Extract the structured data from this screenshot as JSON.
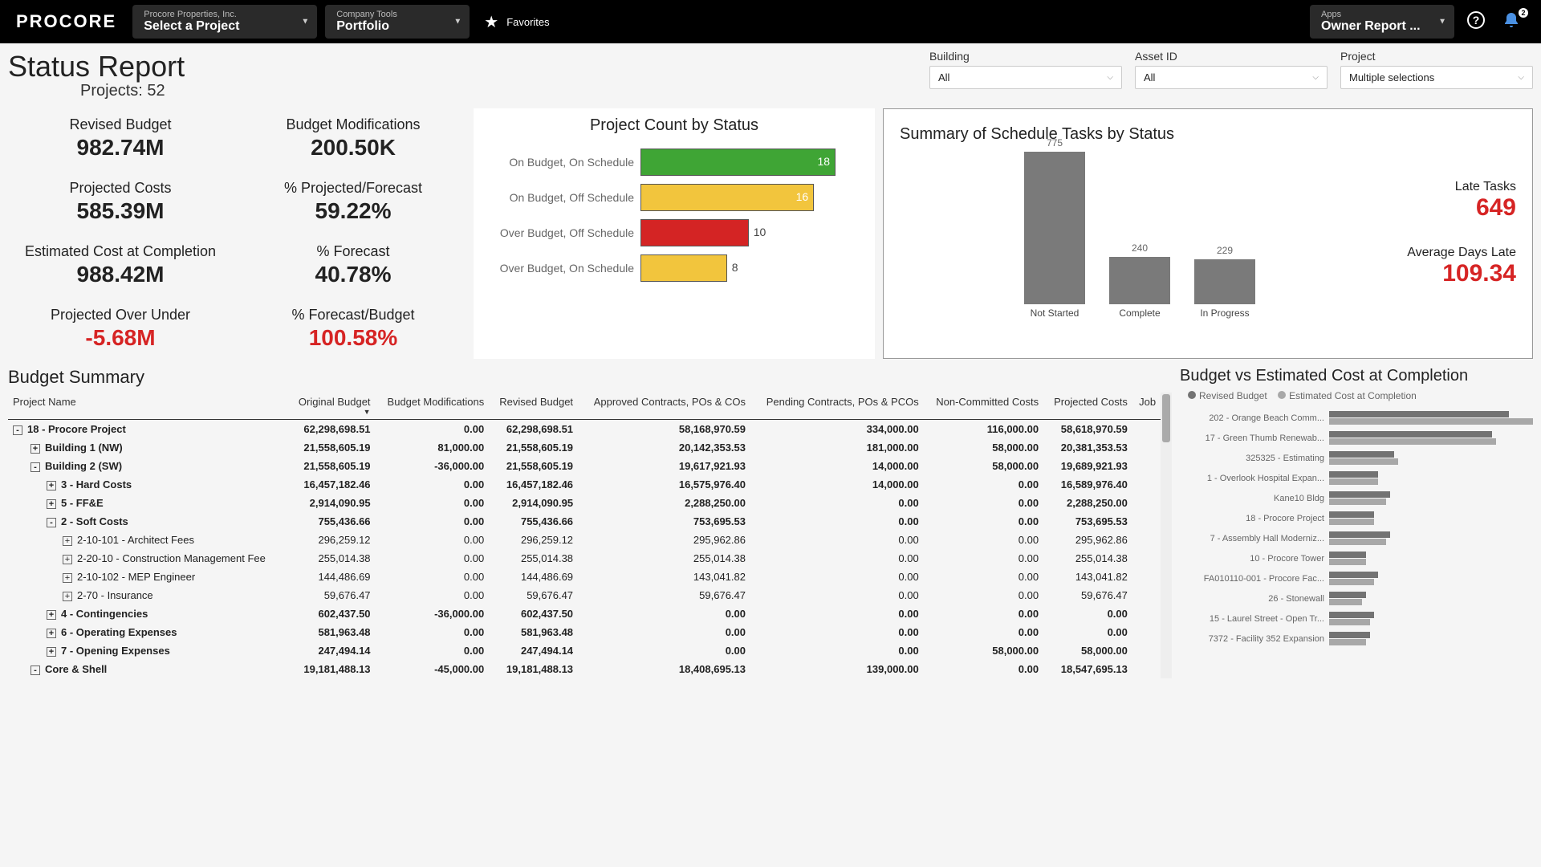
{
  "topbar": {
    "logo": "PROCORE",
    "project_selector": {
      "small": "Procore Properties, Inc.",
      "main": "Select a Project"
    },
    "tool_selector": {
      "small": "Company Tools",
      "main": "Portfolio"
    },
    "favorites": "Favorites",
    "apps_selector": {
      "small": "Apps",
      "main": "Owner Report ..."
    },
    "notif_count": "2"
  },
  "header": {
    "title": "Status Report",
    "subtitle": "Projects: 52",
    "filters": {
      "building": {
        "label": "Building",
        "value": "All"
      },
      "asset": {
        "label": "Asset ID",
        "value": "All"
      },
      "project": {
        "label": "Project",
        "value": "Multiple selections"
      }
    }
  },
  "kpi_left": [
    {
      "label": "Revised Budget",
      "value": "982.74M"
    },
    {
      "label": "Projected Costs",
      "value": "585.39M"
    },
    {
      "label": "Estimated Cost at Completion",
      "value": "988.42M"
    },
    {
      "label": "Projected Over Under",
      "value": "-5.68M",
      "neg": true
    }
  ],
  "kpi_right": [
    {
      "label": "Budget Modifications",
      "value": "200.50K"
    },
    {
      "label": "% Projected/Forecast",
      "value": "59.22%"
    },
    {
      "label": "% Forecast",
      "value": "40.78%"
    },
    {
      "label": "% Forecast/Budget",
      "value": "100.58%",
      "neg": true
    }
  ],
  "chart_data": [
    {
      "type": "bar",
      "title": "Project Count by Status",
      "categories": [
        "On Budget, On Schedule",
        "On Budget, Off Schedule",
        "Over Budget, Off Schedule",
        "Over Budget, On Schedule"
      ],
      "values": [
        18,
        16,
        10,
        8
      ],
      "colors": [
        "#3fa535",
        "#f2c53d",
        "#d42424",
        "#f2c53d"
      ]
    },
    {
      "type": "bar",
      "title": "Summary of Schedule Tasks by Status",
      "categories": [
        "Not Started",
        "Complete",
        "In Progress"
      ],
      "values": [
        775,
        240,
        229
      ]
    },
    {
      "type": "bar",
      "title": "Budget vs Estimated Cost at Completion",
      "categories": [
        "202 - Orange Beach Comm...",
        "17 - Green Thumb Renewab...",
        "325325 - Estimating",
        "1 - Overlook Hospital Expan...",
        "Kane10 Bldg",
        "18 - Procore Project",
        "7 - Assembly Hall Moderniz...",
        "10 - Procore Tower",
        "FA010110-001 - Procore Fac...",
        "26 - Stonewall",
        "15 - Laurel Street - Open Tr...",
        "7372 - Facility 352 Expansion"
      ],
      "series": [
        {
          "name": "Revised Budget",
          "values_pct": [
            88,
            80,
            32,
            24,
            30,
            22,
            30,
            18,
            24,
            18,
            22,
            20
          ]
        },
        {
          "name": "Estimated Cost at Completion",
          "values_pct": [
            100,
            82,
            34,
            24,
            28,
            22,
            28,
            18,
            22,
            16,
            20,
            18
          ]
        }
      ]
    }
  ],
  "schedule_side": {
    "late_label": "Late Tasks",
    "late_value": "649",
    "avg_label": "Average Days Late",
    "avg_value": "109.34"
  },
  "budget_summary": {
    "title": "Budget Summary",
    "columns": [
      "Project Name",
      "Original Budget",
      "Budget Modifications",
      "Revised Budget",
      "Approved Contracts, POs & COs",
      "Pending Contracts, POs & PCOs",
      "Non-Committed Costs",
      "Projected Costs",
      "Job"
    ],
    "rows": [
      {
        "i": 0,
        "t": "18 - Procore Project",
        "e": "-",
        "b": true,
        "v": [
          "62,298,698.51",
          "0.00",
          "62,298,698.51",
          "58,168,970.59",
          "334,000.00",
          "116,000.00",
          "58,618,970.59"
        ]
      },
      {
        "i": 1,
        "t": "Building 1 (NW)",
        "e": "+",
        "b": true,
        "v": [
          "21,558,605.19",
          "81,000.00",
          "21,558,605.19",
          "20,142,353.53",
          "181,000.00",
          "58,000.00",
          "20,381,353.53"
        ]
      },
      {
        "i": 1,
        "t": "Building 2 (SW)",
        "e": "-",
        "b": true,
        "v": [
          "21,558,605.19",
          "-36,000.00",
          "21,558,605.19",
          "19,617,921.93",
          "14,000.00",
          "58,000.00",
          "19,689,921.93"
        ]
      },
      {
        "i": 2,
        "t": "3 - Hard Costs",
        "e": "+",
        "b": true,
        "v": [
          "16,457,182.46",
          "0.00",
          "16,457,182.46",
          "16,575,976.40",
          "14,000.00",
          "0.00",
          "16,589,976.40"
        ]
      },
      {
        "i": 2,
        "t": "5 - FF&E",
        "e": "+",
        "b": true,
        "v": [
          "2,914,090.95",
          "0.00",
          "2,914,090.95",
          "2,288,250.00",
          "0.00",
          "0.00",
          "2,288,250.00"
        ]
      },
      {
        "i": 2,
        "t": "2 - Soft Costs",
        "e": "-",
        "b": true,
        "v": [
          "755,436.66",
          "0.00",
          "755,436.66",
          "753,695.53",
          "0.00",
          "0.00",
          "753,695.53"
        ]
      },
      {
        "i": 3,
        "t": "2-10-101 - Architect Fees",
        "e": "+",
        "b": false,
        "v": [
          "296,259.12",
          "0.00",
          "296,259.12",
          "295,962.86",
          "0.00",
          "0.00",
          "295,962.86"
        ]
      },
      {
        "i": 3,
        "t": "2-20-10 - Construction Management Fee",
        "e": "+",
        "b": false,
        "v": [
          "255,014.38",
          "0.00",
          "255,014.38",
          "255,014.38",
          "0.00",
          "0.00",
          "255,014.38"
        ]
      },
      {
        "i": 3,
        "t": "2-10-102 - MEP Engineer",
        "e": "+",
        "b": false,
        "v": [
          "144,486.69",
          "0.00",
          "144,486.69",
          "143,041.82",
          "0.00",
          "0.00",
          "143,041.82"
        ]
      },
      {
        "i": 3,
        "t": "2-70 - Insurance",
        "e": "+",
        "b": false,
        "v": [
          "59,676.47",
          "0.00",
          "59,676.47",
          "59,676.47",
          "0.00",
          "0.00",
          "59,676.47"
        ]
      },
      {
        "i": 2,
        "t": "4 - Contingencies",
        "e": "+",
        "b": true,
        "v": [
          "602,437.50",
          "-36,000.00",
          "602,437.50",
          "0.00",
          "0.00",
          "0.00",
          "0.00"
        ]
      },
      {
        "i": 2,
        "t": "6 - Operating Expenses",
        "e": "+",
        "b": true,
        "v": [
          "581,963.48",
          "0.00",
          "581,963.48",
          "0.00",
          "0.00",
          "0.00",
          "0.00"
        ]
      },
      {
        "i": 2,
        "t": "7 - Opening Expenses",
        "e": "+",
        "b": true,
        "v": [
          "247,494.14",
          "0.00",
          "247,494.14",
          "0.00",
          "0.00",
          "58,000.00",
          "58,000.00"
        ]
      },
      {
        "i": 1,
        "t": "Core & Shell",
        "e": "-",
        "b": true,
        "v": [
          "19,181,488.13",
          "-45,000.00",
          "19,181,488.13",
          "18,408,695.13",
          "139,000.00",
          "0.00",
          "18,547,695.13"
        ]
      }
    ]
  },
  "bve": {
    "title": "Budget vs Estimated Cost at Completion",
    "legend1": "Revised Budget",
    "legend2": "Estimated Cost at Completion"
  }
}
